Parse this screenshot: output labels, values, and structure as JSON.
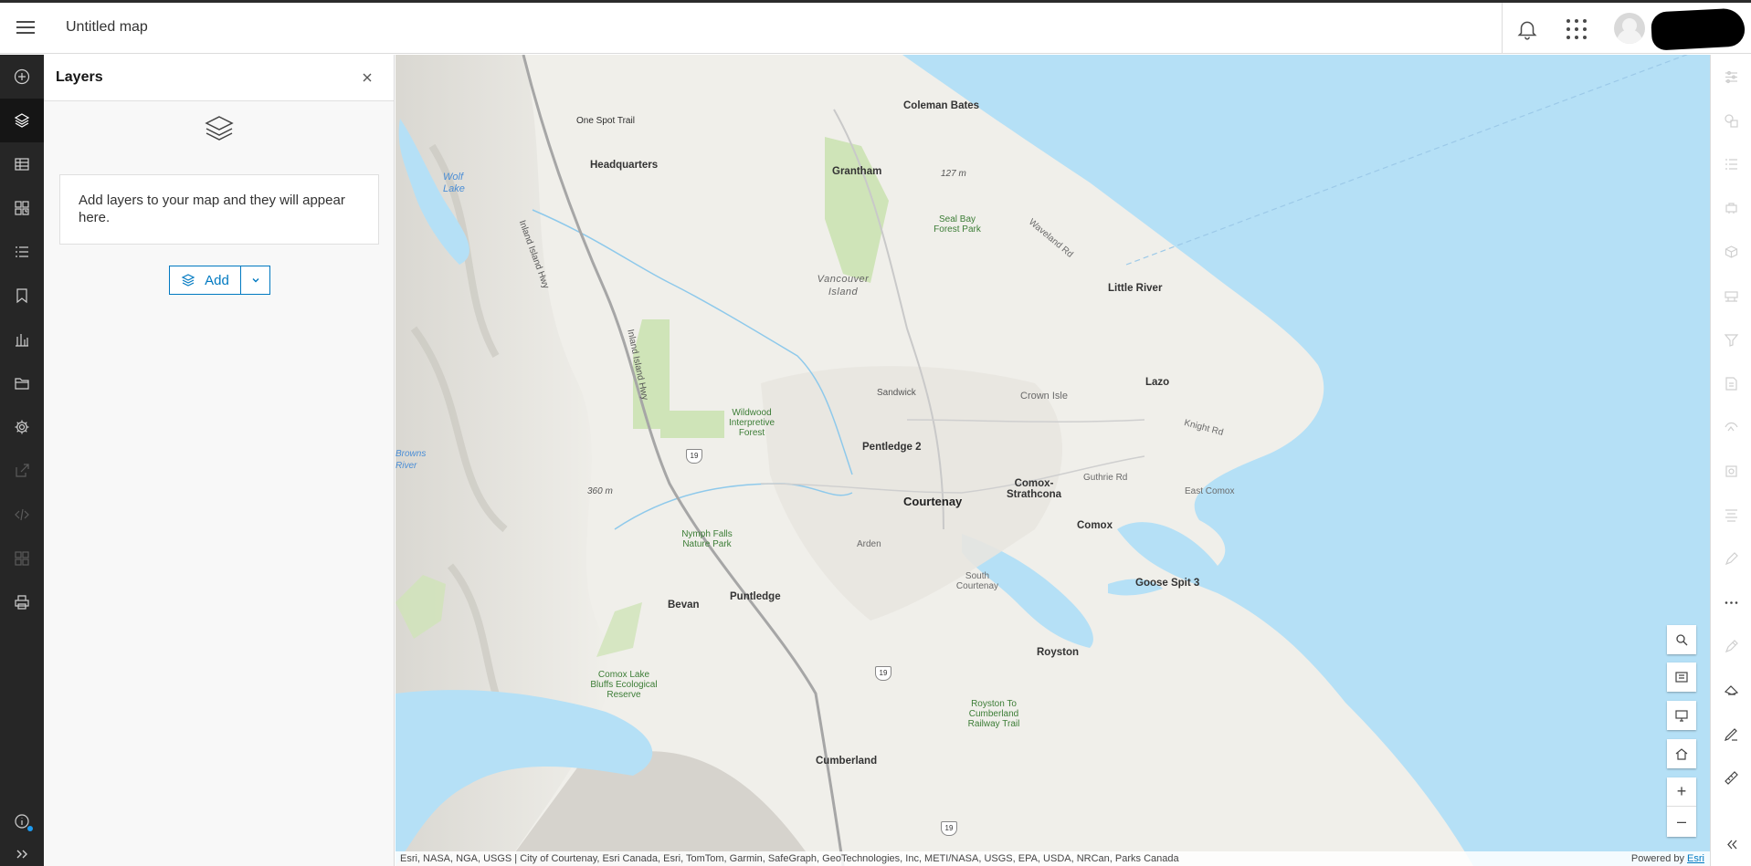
{
  "header": {
    "title": "Untitled map"
  },
  "left_rail": {
    "items": [
      {
        "id": "add",
        "icon": "add-circle-icon"
      },
      {
        "id": "layers",
        "icon": "layers-icon",
        "active": true
      },
      {
        "id": "tables",
        "icon": "table-icon"
      },
      {
        "id": "basemap",
        "icon": "basemap-icon"
      },
      {
        "id": "legend",
        "icon": "legend-icon"
      },
      {
        "id": "bookmarks",
        "icon": "bookmark-icon"
      },
      {
        "id": "charts",
        "icon": "chart-icon"
      },
      {
        "id": "properties",
        "icon": "folder-icon"
      },
      {
        "id": "settings",
        "icon": "gear-icon"
      },
      {
        "id": "share",
        "icon": "share-icon",
        "disabled": true
      },
      {
        "id": "embed",
        "icon": "code-icon",
        "disabled": true
      },
      {
        "id": "apps",
        "icon": "apps-icon",
        "disabled": true
      },
      {
        "id": "print",
        "icon": "print-icon"
      }
    ]
  },
  "layers_panel": {
    "title": "Layers",
    "empty_message": "Add layers to your map and they will appear here.",
    "add_label": "Add"
  },
  "map": {
    "labels": {
      "coleman_bates": "Coleman Bates",
      "one_spot_trail": "One Spot Trail",
      "headquarters": "Headquarters",
      "grantham": "Grantham",
      "wolf_lake": "Wolf Lake",
      "inland_island_hwy_north": "Inland Island Hwy",
      "inland_island_hwy_south": "Inland Island Hwy",
      "seal_bay": "Seal Bay Forest Park",
      "waveland_rd": "Waveland Rd",
      "elev_127": "127 m",
      "vancouver_island": "Vancouver Island",
      "little_river": "Little River",
      "sandwick": "Sandwick",
      "crown_isle": "Crown Isle",
      "lazo": "Lazo",
      "knight_rd": "Knight Rd",
      "wildwood": "Wildwood Interpretive Forest",
      "pentledge_2": "Pentledge 2",
      "comox_strathcona": "Comox-Strathcona",
      "guthrie_rd": "Guthrie Rd",
      "east_comox": "East Comox",
      "courtenay": "Courtenay",
      "comox": "Comox",
      "elev_360": "360 m",
      "browns_river": "Browns River",
      "nymph_falls": "Nymph Falls Nature Park",
      "arden": "Arden",
      "south_courtenay": "South Courtenay",
      "goose_spit_3": "Goose Spit 3",
      "bevan": "Bevan",
      "puntledge": "Puntledge",
      "royston": "Royston",
      "comox_lake_bluffs": "Comox Lake Bluffs Ecological Reserve",
      "royston_trail": "Royston To Cumberland Railway Trail",
      "cumberland": "Cumberland",
      "hwy_19_a": "19",
      "hwy_19_b": "19",
      "hwy_19_c": "19"
    },
    "attribution": "Esri, NASA, NGA, USGS | City of Courtenay, Esri Canada, Esri, TomTom, Garmin, SafeGraph, GeoTechnologies, Inc, METI/NASA, USGS, EPA, USDA, NRCan, Parks Canada",
    "powered_by": "Powered by",
    "powered_by_link": "Esri",
    "zoom_in": "+",
    "zoom_out": "–"
  },
  "right_rail": {
    "items": [
      {
        "icon": "properties-icon",
        "disabled": true
      },
      {
        "icon": "styles-icon",
        "disabled": true
      },
      {
        "icon": "filter-icon",
        "disabled": true
      },
      {
        "icon": "effects-icon",
        "disabled": true
      },
      {
        "icon": "popups-icon",
        "disabled": true
      },
      {
        "icon": "fields-icon",
        "disabled": true
      },
      {
        "icon": "labels-icon",
        "disabled": true
      },
      {
        "icon": "forms-icon",
        "disabled": true
      },
      {
        "icon": "configure-icon",
        "disabled": true
      },
      {
        "icon": "layer-settings-icon",
        "disabled": true
      },
      {
        "icon": "align-icon",
        "disabled": true
      },
      {
        "icon": "sketch-icon",
        "disabled": true
      },
      {
        "icon": "more-icon"
      },
      {
        "icon": "edit-icon",
        "disabled": true
      },
      {
        "icon": "directions-icon"
      },
      {
        "icon": "draw-icon"
      },
      {
        "icon": "measure-icon"
      },
      {
        "icon": "collapse-icon"
      }
    ]
  }
}
